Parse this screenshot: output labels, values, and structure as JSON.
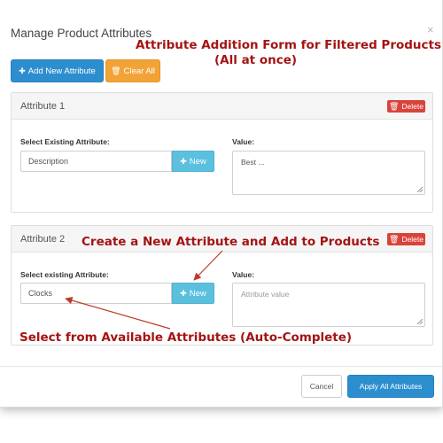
{
  "modal": {
    "title": "Manage Product Attributes",
    "close_glyph": "×"
  },
  "toolbar": {
    "add_new_label": "Add New Attribute",
    "clear_all_label": "Clear All"
  },
  "attributes": [
    {
      "title": "Attribute 1",
      "delete_label": "Delete",
      "select_label": "Select Existing Attribute:",
      "select_value": "Description",
      "new_label": "New",
      "value_label": "Value:",
      "value_text": "Best ..."
    },
    {
      "title": "Attribute 2",
      "delete_label": "Delete",
      "select_label": "Select existing Attribute:",
      "select_value": "Clocks",
      "new_label": "New",
      "value_label": "Value:",
      "value_placeholder": "Attribute value"
    }
  ],
  "footer": {
    "cancel_label": "Cancel",
    "apply_label": "Apply All Attributes"
  },
  "annotations": {
    "header_line1": "Attribute Addition Form for Filtered Products",
    "header_line2": "(All at once)",
    "create_new": "Create a New Attribute and Add to Products",
    "select_available": "Select from Available Attributes (Auto-Complete)"
  },
  "icons": {
    "add": "plus-icon",
    "clear": "trash-icon",
    "delete": "trash-icon",
    "close": "close-icon"
  },
  "colors": {
    "primary": "#2d8ecf",
    "warning": "#f2a337",
    "danger": "#d9433a",
    "info": "#5bc0de",
    "annotation": "#a51313"
  }
}
